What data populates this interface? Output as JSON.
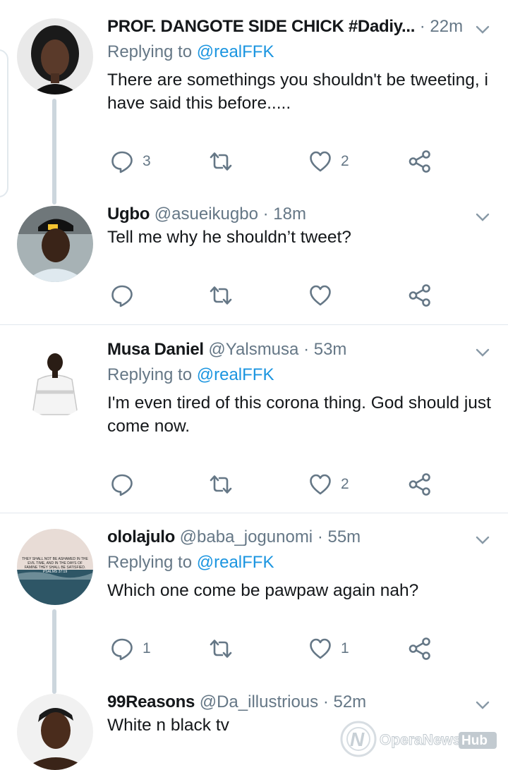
{
  "tweets": [
    {
      "name": "PROF. DANGOTE SIDE CHICK #Dadiy...",
      "handle": "",
      "time": "· 22m",
      "replying_label": "Replying to",
      "replying_handle": "@realFFK",
      "text": "There are somethings you shouldn't be tweeting, i have said this before.....",
      "reply_count": "3",
      "retweet_count": "",
      "like_count": "2"
    },
    {
      "name": "Ugbo",
      "handle": "@asueikugbo",
      "time": "· 18m",
      "text": "Tell me why he shouldn’t tweet?",
      "reply_count": "",
      "retweet_count": "",
      "like_count": ""
    },
    {
      "name": "Musa Daniel",
      "handle": "@Yalsmusa",
      "time": "· 53m",
      "replying_label": "Replying to",
      "replying_handle": "@realFFK",
      "text": "I'm even tired of this corona thing. God should just come now.",
      "reply_count": "",
      "retweet_count": "",
      "like_count": "2"
    },
    {
      "name": "ololajulo",
      "handle": "@baba_jogunomi",
      "time": "· 55m",
      "replying_label": "Replying to",
      "replying_handle": "@realFFK",
      "text": "Which one come be pawpaw again nah?",
      "reply_count": "1",
      "retweet_count": "",
      "like_count": "1",
      "avatar_text": "THEY SHALL NOT BE ASHAMED IN THE EVIL TIME, AND IN THE DAYS OF FAMINE THEY SHALL BE SATISFIED. PSALMS 37:19"
    },
    {
      "name": "99Reasons",
      "handle": "@Da_illustrious",
      "time": "· 52m",
      "text": "White n black tv"
    }
  ],
  "watermark": {
    "brand": "OperaNews",
    "suffix": "Hub"
  },
  "colors": {
    "link": "#1b95e0",
    "secondary": "#657786",
    "divider": "#e1e8ed",
    "thread": "#ccd6dd"
  },
  "icons": [
    "reply-icon",
    "retweet-icon",
    "like-icon",
    "share-icon",
    "chevron-down-icon"
  ]
}
